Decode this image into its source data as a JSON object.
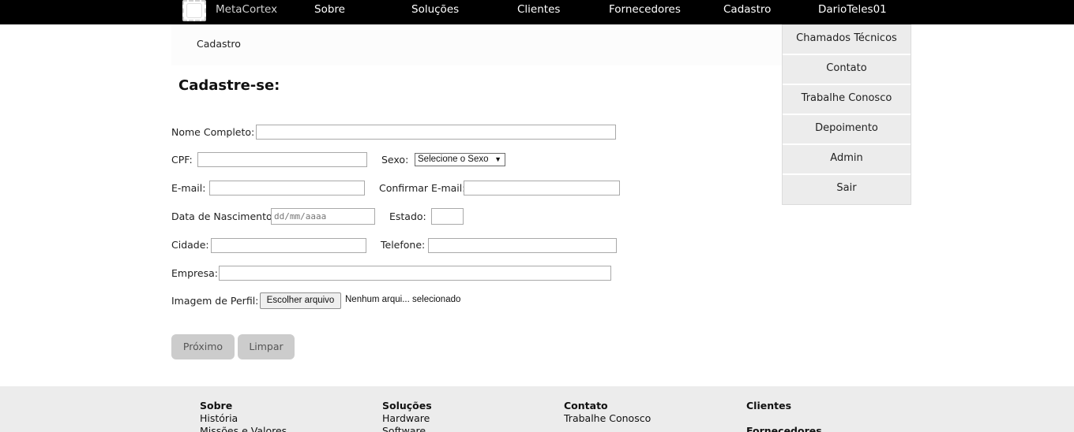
{
  "navbar": {
    "brand": "MetaCortex",
    "items": [
      "Sobre",
      "Soluções",
      "Clientes",
      "Fornecedores",
      "Cadastro",
      "DarioTeles01"
    ]
  },
  "breadcrumb": {
    "current": "Cadastro"
  },
  "user_menu": {
    "items": [
      "Chamados Técnicos",
      "Contato",
      "Trabalhe Conosco",
      "Depoimento",
      "Admin",
      "Sair"
    ]
  },
  "page": {
    "title": "Cadastre-se:"
  },
  "form": {
    "nome_label": "Nome Completo:",
    "nome_value": "",
    "cpf_label": "CPF:",
    "cpf_value": "",
    "sexo_label": "Sexo:",
    "sexo_selected": "Selecione o Sexo",
    "email_label": "E-mail:",
    "email_value": "",
    "confirmar_email_label": "Confirmar E-mail:",
    "confirmar_email_value": "",
    "nascimento_label": "Data de Nascimento:",
    "nascimento_placeholder": "dd/mm/aaaa",
    "estado_label": "Estado:",
    "estado_value": "",
    "cidade_label": "Cidade:",
    "cidade_value": "",
    "telefone_label": "Telefone:",
    "telefone_value": "",
    "empresa_label": "Empresa:",
    "empresa_value": "",
    "imagem_label": "Imagem de Perfil:",
    "file_button": "Escolher arquivo",
    "file_status": "Nenhum arqui... selecionado",
    "next_button": "Próximo",
    "clear_button": "Limpar"
  },
  "footer": {
    "col1": {
      "heading": "Sobre",
      "links": [
        "História",
        "Missões e Valores"
      ]
    },
    "col2": {
      "heading": "Soluções",
      "links": [
        "Hardware",
        "Software"
      ]
    },
    "col3": {
      "heading": "Contato",
      "links": [
        "Trabalhe Conosco"
      ]
    },
    "col4": {
      "heading": "Clientes",
      "heading2": "Fornecedores"
    }
  },
  "colors": {
    "navbar_bg": "#000000",
    "menu_bg": "#ececec",
    "button_bg": "#cccccc",
    "footer_bg": "#ececec"
  },
  "icons": {
    "logo": "logo-icon",
    "select_caret": "caret-down-icon"
  }
}
